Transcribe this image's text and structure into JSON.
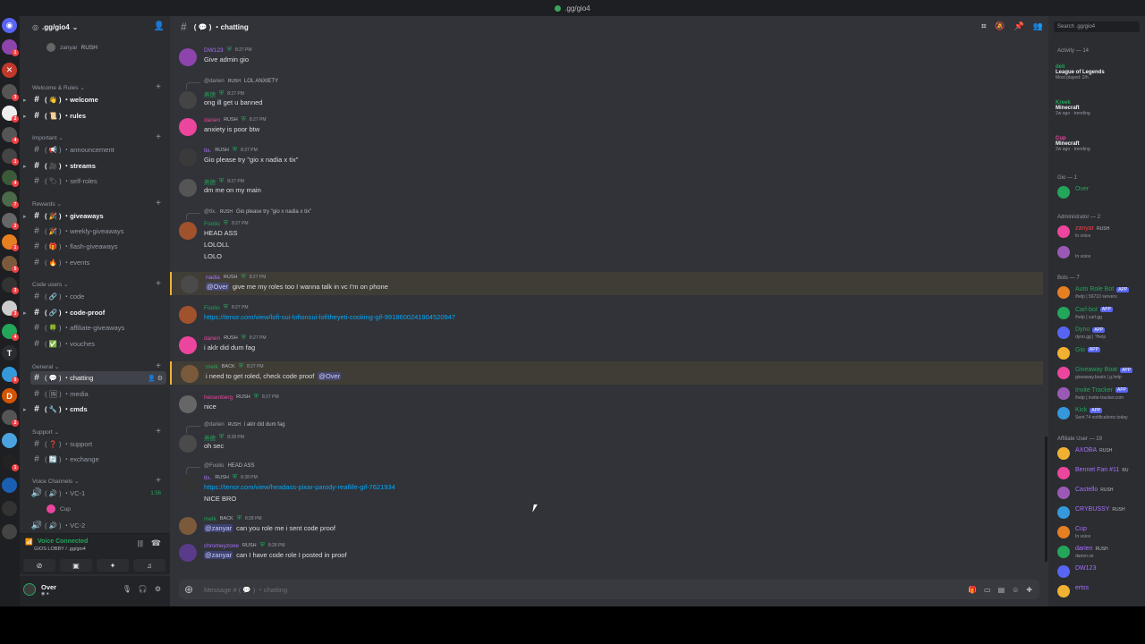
{
  "window": {
    "title": ".gg/gio4"
  },
  "server": {
    "name": ".gg/gio4"
  },
  "top_voice": {
    "user": "zanyar",
    "tag": "RUSH"
  },
  "categories": {
    "welcome": "Welcome & Rules",
    "important": "Important",
    "rewards": "Rewards",
    "code_users": "Code users",
    "general": "General",
    "support": "Support",
    "voice": "Voice Channels"
  },
  "channels": {
    "welcome": "welcome",
    "rules": "rules",
    "announcement": "announcement",
    "streams": "streams",
    "self_roles": "self-roles",
    "giveaways": "giveaways",
    "weekly_giveaways": "weekly-giveaways",
    "flash_giveaways": "flash-giveaways",
    "events": "events",
    "code": "code",
    "code_proof": "code-proof",
    "affiliate_giveaways": "affiliate-giveaways",
    "vouches": "vouches",
    "chatting": "chatting",
    "media": "media",
    "cmds": "cmds",
    "support": "support",
    "exchange": "exchange",
    "vc1": "VC-1",
    "vc1_time": "1:56",
    "vc1_user": "Cup",
    "vc2": "VC-2"
  },
  "voice_panel": {
    "title": "Voice Connected",
    "sub": "GIOS LOBBY / .gg/gio4"
  },
  "user_panel": {
    "name": "Over"
  },
  "header": {
    "channel": "chatting"
  },
  "composer": {
    "placeholder": "Message # ( 💬 ) ・chatting"
  },
  "messages": [
    {
      "author": "DW123",
      "color": "#a970ff",
      "time": "8:27 PM",
      "lines": [
        "Give admin gio"
      ]
    },
    {
      "reply_to": "@darien",
      "reply_tag": "RUSH",
      "reply_text": "LOL ANXIETY",
      "author": "燕德",
      "color": "#23a55a",
      "time": "8:27 PM",
      "lines": [
        "ong ill get u banned"
      ]
    },
    {
      "author": "darien",
      "tag": "RUSH",
      "color": "#eb459e",
      "time": "8:27 PM",
      "lines": [
        "anxiety is poor btw"
      ]
    },
    {
      "author": "tix.",
      "tag": "RUSH",
      "color": "#a970ff",
      "time": "8:27 PM",
      "lines": [
        "Gio please try  \"gio x nadia x tix\""
      ]
    },
    {
      "author": "燕德",
      "color": "#23a55a",
      "time": "8:27 PM",
      "lines": [
        "dm me on my main"
      ]
    },
    {
      "reply_to": "@tix.",
      "reply_tag": "RUSH",
      "reply_text": "Gio please try  \"gio x nadia x tix\"",
      "author": "Foolio",
      "color": "#23a55a",
      "time": "8:27 PM",
      "lines": [
        "HEAD ASS",
        "LOLOLL",
        "LOLO"
      ]
    },
    {
      "author": "nadia",
      "tag": "RUSH",
      "color": "#a970ff",
      "time": "8:27 PM",
      "mention": "@Over",
      "lines": [
        "give me my roles too I wanna talk in vc I'm on phone"
      ]
    },
    {
      "author": "Foolio",
      "color": "#23a55a",
      "time": "8:27 PM",
      "link": "https://tenor.com/view/lofi-sui-lofionsui-lofitheyeti-cooking-gif-9918600241904520947"
    },
    {
      "author": "darien",
      "tag": "RUSH",
      "color": "#eb459e",
      "time": "8:27 PM",
      "lines": [
        "i aklr did dum fag"
      ]
    },
    {
      "author": "melk",
      "tag": "BACK",
      "color": "#23a55a",
      "time": "8:27 PM",
      "lines": [
        "i need to get roled, check code proof"
      ],
      "trail_mention": "@Over"
    },
    {
      "author": "heisenberg",
      "tag": "RUSH",
      "color": "#eb459e",
      "time": "8:27 PM",
      "lines": [
        "nice"
      ]
    },
    {
      "reply_to": "@darien",
      "reply_tag": "RUSH",
      "reply_text": "i aklr did dum fag",
      "author": "燕德",
      "color": "#23a55a",
      "time": "8:28 PM",
      "lines": [
        "oh sec"
      ]
    },
    {
      "reply_to": "@Foolio",
      "reply_text": "HEAD ASS",
      "author": "tix.",
      "tag": "RUSH",
      "color": "#a970ff",
      "time": "8:28 PM",
      "link": "https://tenor.com/view/headass-pixar-parody-reallife-gif-7621934",
      "lines2": "NICE BRO"
    },
    {
      "author": "melk",
      "tag": "BACK",
      "color": "#23a55a",
      "time": "8:28 PM",
      "mention": "@zanyar",
      "lines": [
        "can you role me i sent code proof"
      ]
    },
    {
      "author": "chromeyzone",
      "tag": "RUSH",
      "color": "#a970ff",
      "time": "8:28 PM",
      "mention": "@zanyar",
      "lines": [
        "can I have code role I posted in proof"
      ]
    }
  ],
  "member_list": {
    "search": "Search .gg/gio4",
    "activity_header": "Activity — 14",
    "activities": [
      {
        "name": "deli",
        "game": "League of Legends",
        "sub": "Most played: 2/h",
        "color": "#23a55a"
      },
      {
        "name": "Kreek",
        "game": "Minecraft",
        "sub": "2w ago · trending",
        "color": "#23a55a"
      },
      {
        "name": "Cup",
        "game": "Minecraft",
        "sub": "2w ago · trending",
        "color": "#eb459e"
      }
    ],
    "groups": [
      {
        "title": "Gio — 1",
        "members": [
          {
            "name": "Over",
            "color": "#23a55a",
            "sub": ""
          }
        ]
      },
      {
        "title": "Administrator — 2",
        "members": [
          {
            "name": "zanyar",
            "tag": "RUSH",
            "color": "#f23f43",
            "sub": "In voice"
          },
          {
            "name": "",
            "color": "#f23f43",
            "sub": "In voice"
          }
        ]
      },
      {
        "title": "Bots — 7",
        "members": [
          {
            "name": "Auto Role Bot",
            "app": "APP",
            "color": "#23a55a",
            "sub": "/help | 56710 servers"
          },
          {
            "name": "Carl-bot",
            "app": "APP",
            "color": "#23a55a",
            "sub": "/help | carl.gg"
          },
          {
            "name": "Dyno",
            "app": "APP",
            "color": "#23a55a",
            "sub": "dyno.gg | ?help"
          },
          {
            "name": "Gio",
            "app": "APP",
            "color": "#23a55a",
            "sub": ""
          },
          {
            "name": "Giveaway Boat",
            "app": "APP",
            "color": "#23a55a",
            "sub": "giveaway.boats | g.help"
          },
          {
            "name": "Invite Tracker",
            "app": "APP",
            "color": "#23a55a",
            "sub": "/help | invite-tracker.com"
          },
          {
            "name": "Kick",
            "app": "APP",
            "color": "#23a55a",
            "sub": "Sent 74 notifications today"
          }
        ]
      },
      {
        "title": "Affiliate User — 19",
        "members": [
          {
            "name": "AXOBA",
            "tag": "RUSH",
            "color": "#a970ff",
            "sub": ""
          },
          {
            "name": "Bennet Fan #11",
            "tag": "RU",
            "color": "#a970ff",
            "sub": ""
          },
          {
            "name": "Castello",
            "tag": "RUSH",
            "color": "#a970ff",
            "sub": ""
          },
          {
            "name": "CRYBUSSY",
            "tag": "RUSH",
            "color": "#a970ff",
            "sub": ""
          },
          {
            "name": "Cup",
            "color": "#a970ff",
            "sub": "In voice"
          },
          {
            "name": "darien",
            "tag": "RUSH",
            "color": "#a970ff",
            "sub": "darien.se"
          },
          {
            "name": "DW123",
            "color": "#a970ff",
            "sub": ""
          },
          {
            "name": "ertss",
            "color": "#a970ff",
            "sub": ""
          }
        ]
      }
    ]
  }
}
